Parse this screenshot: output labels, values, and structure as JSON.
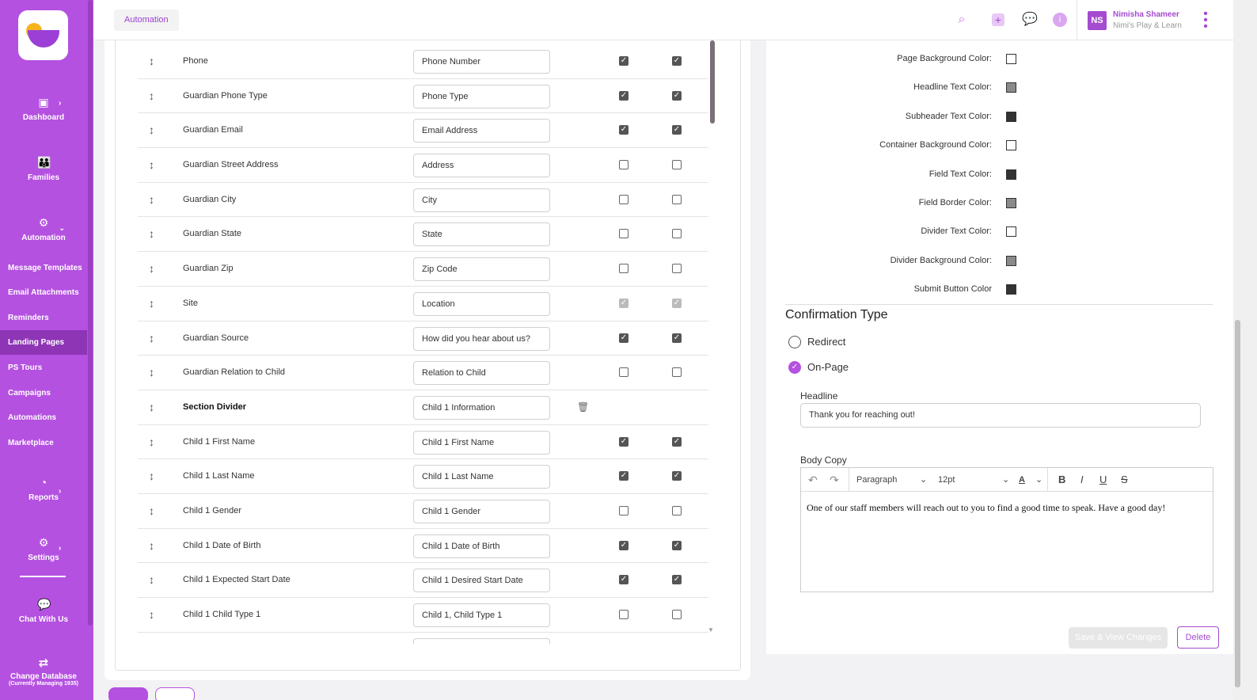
{
  "sidebar": {
    "dashboard": "Dashboard",
    "families": "Families",
    "automation": "Automation",
    "sub_items": [
      "Message Templates",
      "Email Attachments",
      "Reminders",
      "Landing Pages",
      "PS Tours",
      "Campaigns",
      "Automations",
      "Marketplace"
    ],
    "active_item": "Landing Pages",
    "reports": "Reports",
    "settings": "Settings",
    "chat": "Chat With Us",
    "change_db": "Change Database",
    "change_db_sub": "(Currently Managing 1935)"
  },
  "topbar": {
    "breadcrumb": "Automation",
    "user_initials": "NS",
    "user_name": "Nimisha Shameer",
    "user_org": "Nimi's Play & Learn"
  },
  "fields": [
    {
      "label": "Phone",
      "value": "Phone Number",
      "c1": "on",
      "c2": "on"
    },
    {
      "label": "Guardian Phone Type",
      "value": "Phone Type",
      "c1": "on",
      "c2": "on"
    },
    {
      "label": "Guardian Email",
      "value": "Email Address",
      "c1": "on",
      "c2": "on"
    },
    {
      "label": "Guardian Street Address",
      "value": "Address",
      "c1": "off",
      "c2": "off"
    },
    {
      "label": "Guardian City",
      "value": "City",
      "c1": "off",
      "c2": "off"
    },
    {
      "label": "Guardian State",
      "value": "State",
      "c1": "off",
      "c2": "off"
    },
    {
      "label": "Guardian Zip",
      "value": "Zip Code",
      "c1": "off",
      "c2": "off"
    },
    {
      "label": "Site",
      "value": "Location",
      "c1": "dim",
      "c2": "dim"
    },
    {
      "label": "Guardian Source",
      "value": "How did you hear about us?",
      "c1": "on",
      "c2": "on"
    },
    {
      "label": "Guardian Relation to Child",
      "value": "Relation to Child",
      "c1": "off",
      "c2": "off"
    },
    {
      "label": "Section Divider",
      "value": "Child 1 Information",
      "divider": true
    },
    {
      "label": "Child 1 First Name",
      "value": "Child 1 First Name",
      "c1": "on",
      "c2": "on"
    },
    {
      "label": "Child 1 Last Name",
      "value": "Child 1 Last Name",
      "c1": "on",
      "c2": "on"
    },
    {
      "label": "Child 1 Gender",
      "value": "Child 1 Gender",
      "c1": "off",
      "c2": "off"
    },
    {
      "label": "Child 1 Date of Birth",
      "value": "Child 1 Date of Birth",
      "c1": "on",
      "c2": "on"
    },
    {
      "label": "Child 1 Expected Start Date",
      "value": "Child 1 Desired Start Date",
      "c1": "on",
      "c2": "on"
    },
    {
      "label": "Child 1 Child Type 1",
      "value": "Child 1, Child Type 1",
      "c1": "off",
      "c2": "off"
    }
  ],
  "colors": [
    {
      "label": "Page Background Color:",
      "color": "#ffffff"
    },
    {
      "label": "Headline Text Color:",
      "color": "#8a8a8a"
    },
    {
      "label": "Subheader Text Color:",
      "color": "#333333"
    },
    {
      "label": "Container Background Color:",
      "color": "#ffffff"
    },
    {
      "label": "Field Text Color:",
      "color": "#333333"
    },
    {
      "label": "Field Border Color:",
      "color": "#8a8a8a"
    },
    {
      "label": "Divider Text Color:",
      "color": "#ffffff"
    },
    {
      "label": "Divider Background Color:",
      "color": "#8a8a8a"
    },
    {
      "label": "Submit Button Color",
      "color": "#333333"
    }
  ],
  "confirmation": {
    "title": "Confirmation Type",
    "redirect": "Redirect",
    "onpage": "On-Page",
    "headline_label": "Headline",
    "headline_value": "Thank you for reaching out!",
    "body_label": "Body Copy",
    "paragraph": "Paragraph",
    "font_size": "12pt",
    "body_text": "One of our staff members will reach out to you to find a good time to speak. Have a good day!"
  },
  "buttons": {
    "save": "Save & View Changes",
    "delete": "Delete"
  },
  "accent": "#b451e0"
}
